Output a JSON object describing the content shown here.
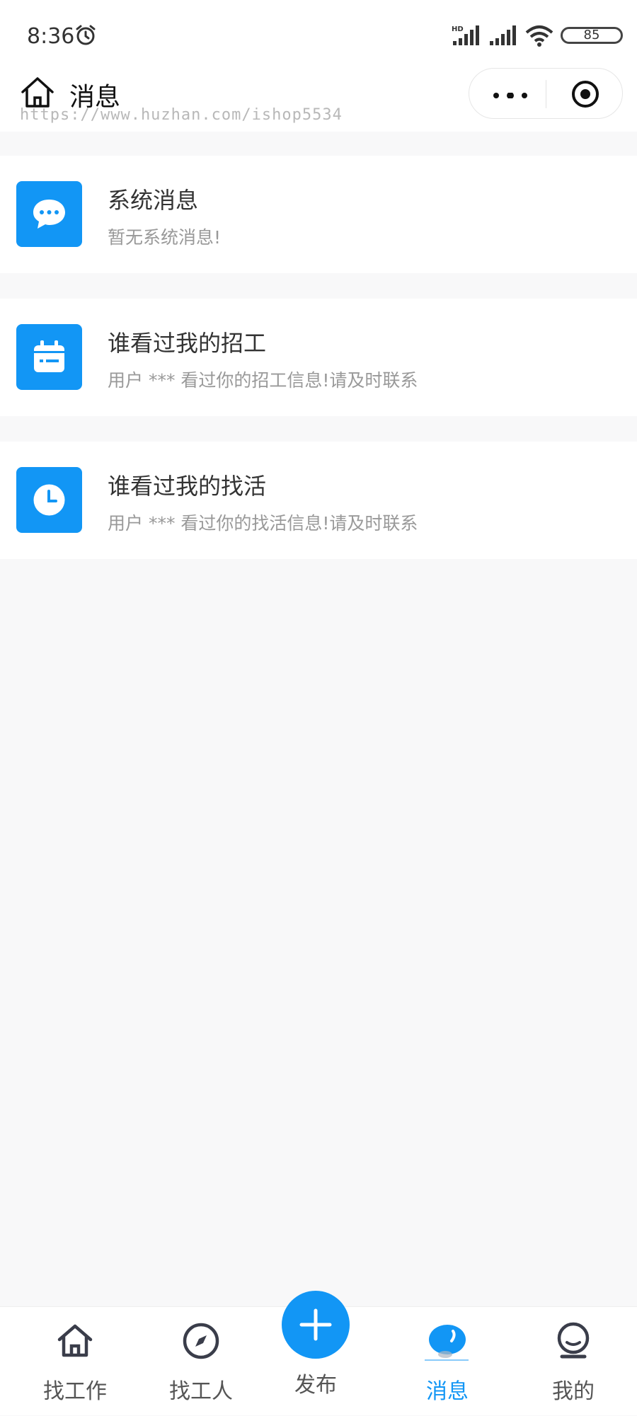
{
  "status_bar": {
    "time": "8:36",
    "network_label": "HD",
    "battery": "85"
  },
  "nav": {
    "title": "消息",
    "watermark": "https://www.huzhan.com/ishop5534"
  },
  "messages": [
    {
      "title": "系统消息",
      "subtitle": "暂无系统消息!",
      "icon": "chat-bubble-icon"
    },
    {
      "title": "谁看过我的招工",
      "subtitle": "用户 *** 看过你的招工信息!请及时联系",
      "icon": "calendar-icon"
    },
    {
      "title": "谁看过我的找活",
      "subtitle": "用户 *** 看过你的找活信息!请及时联系",
      "icon": "clock-icon"
    }
  ],
  "tabbar": {
    "find_job": "找工作",
    "find_worker": "找工人",
    "publish": "发布",
    "messages": "消息",
    "mine": "我的"
  },
  "colors": {
    "accent": "#1296f5",
    "background": "#f8f8f9",
    "subtitle_text": "#999999"
  }
}
